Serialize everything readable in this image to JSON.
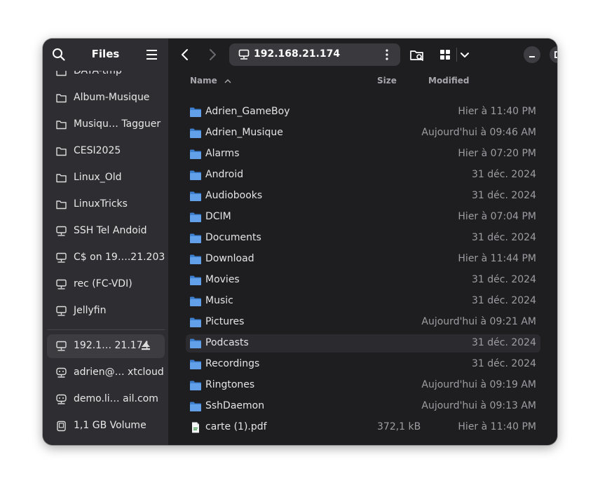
{
  "sidebar": {
    "title": "Files",
    "items": [
      {
        "label": "DATA-tmp",
        "icon": "folder-icon"
      },
      {
        "label": "Album-Musique",
        "icon": "folder-icon"
      },
      {
        "label": "Musiqu… Tagguer",
        "icon": "folder-icon"
      },
      {
        "label": "CESI2025",
        "icon": "folder-icon"
      },
      {
        "label": "Linux_Old",
        "icon": "folder-icon"
      },
      {
        "label": "LinuxTricks",
        "icon": "folder-icon"
      },
      {
        "label": "SSH Tel Andoid",
        "icon": "network-icon"
      },
      {
        "label": "C$ on 19….21.203",
        "icon": "network-icon"
      },
      {
        "label": "rec (FC-VDI)",
        "icon": "network-icon"
      },
      {
        "label": "Jellyfin",
        "icon": "network-icon"
      }
    ],
    "devices": [
      {
        "label": "192.1…  21.174",
        "icon": "network-icon",
        "selected": true
      },
      {
        "label": "adrien@… xtcloud",
        "icon": "online-account-icon"
      },
      {
        "label": "demo.li…   ail.com",
        "icon": "online-account-icon"
      },
      {
        "label": "1,1 GB Volume",
        "icon": "drive-icon"
      }
    ]
  },
  "pathbar": {
    "location": "192.168.21.174"
  },
  "columns": {
    "name": "Name",
    "size": "Size",
    "modified": "Modified"
  },
  "files": [
    {
      "name": "Adrien_GameBoy",
      "size": "",
      "modified": "Hier à 11:40 PM",
      "type": "folder"
    },
    {
      "name": "Adrien_Musique",
      "size": "",
      "modified": "Aujourd'hui à 09:46 AM",
      "type": "folder"
    },
    {
      "name": "Alarms",
      "size": "",
      "modified": "Hier à 07:20 PM",
      "type": "folder"
    },
    {
      "name": "Android",
      "size": "",
      "modified": "31 déc. 2024",
      "type": "folder"
    },
    {
      "name": "Audiobooks",
      "size": "",
      "modified": "31 déc. 2024",
      "type": "folder"
    },
    {
      "name": "DCIM",
      "size": "",
      "modified": "Hier à 07:04 PM",
      "type": "folder"
    },
    {
      "name": "Documents",
      "size": "",
      "modified": "31 déc. 2024",
      "type": "folder"
    },
    {
      "name": "Download",
      "size": "",
      "modified": "Hier à 11:44 PM",
      "type": "folder"
    },
    {
      "name": "Movies",
      "size": "",
      "modified": "31 déc. 2024",
      "type": "folder"
    },
    {
      "name": "Music",
      "size": "",
      "modified": "31 déc. 2024",
      "type": "folder"
    },
    {
      "name": "Pictures",
      "size": "",
      "modified": "Aujourd'hui à 09:21 AM",
      "type": "folder"
    },
    {
      "name": "Podcasts",
      "size": "",
      "modified": "31 déc. 2024",
      "type": "folder",
      "hover": true
    },
    {
      "name": "Recordings",
      "size": "",
      "modified": "31 déc. 2024",
      "type": "folder"
    },
    {
      "name": "Ringtones",
      "size": "",
      "modified": "Aujourd'hui à 09:19 AM",
      "type": "folder"
    },
    {
      "name": "SshDaemon",
      "size": "",
      "modified": "Aujourd'hui à 09:13 AM",
      "type": "folder"
    },
    {
      "name": "carte (1).pdf",
      "size": "372,1 kB",
      "modified": "Hier à 11:40 PM",
      "type": "pdf"
    }
  ],
  "colors": {
    "accent_folder": "#62a0ea",
    "window_bg": "#1e1e20",
    "sidebar_bg": "#2e2e32"
  }
}
